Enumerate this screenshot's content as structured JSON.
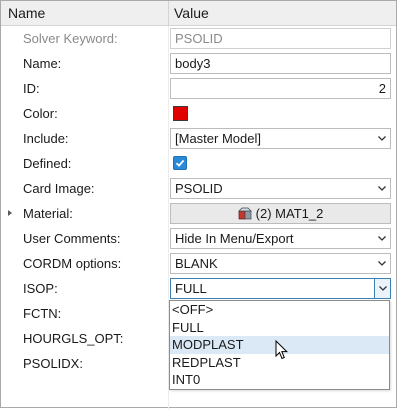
{
  "header": {
    "name_col": "Name",
    "value_col": "Value"
  },
  "rows": {
    "solver_keyword": {
      "label": "Solver Keyword:",
      "value": "PSOLID"
    },
    "name": {
      "label": "Name:",
      "value": "body3"
    },
    "id": {
      "label": "ID:",
      "value": "2"
    },
    "color": {
      "label": "Color:",
      "swatch_color": "#e00000"
    },
    "include": {
      "label": "Include:",
      "value": "[Master Model]"
    },
    "defined": {
      "label": "Defined:",
      "checked": true
    },
    "card_image": {
      "label": "Card Image:",
      "value": "PSOLID"
    },
    "material": {
      "label": "Material:",
      "value": "(2) MAT1_2",
      "icon": "material-icon"
    },
    "user_comments": {
      "label": "User Comments:",
      "value": "Hide In Menu/Export"
    },
    "cordm": {
      "label": "CORDM options:",
      "value": "BLANK"
    },
    "isop": {
      "label": "ISOP:",
      "value": "FULL"
    },
    "fctn": {
      "label": "FCTN:"
    },
    "hourgls": {
      "label": "HOURGLS_OPT:"
    },
    "psolidx": {
      "label": "PSOLIDX:"
    }
  },
  "isop_dropdown": {
    "options": [
      "<OFF>",
      "FULL",
      "MODPLAST",
      "REDPLAST",
      "INT0"
    ],
    "highlighted": "MODPLAST"
  },
  "colors": {
    "accent": "#2b8ad8",
    "highlight": "#dbe9f6",
    "header_bg": "#efefef"
  }
}
